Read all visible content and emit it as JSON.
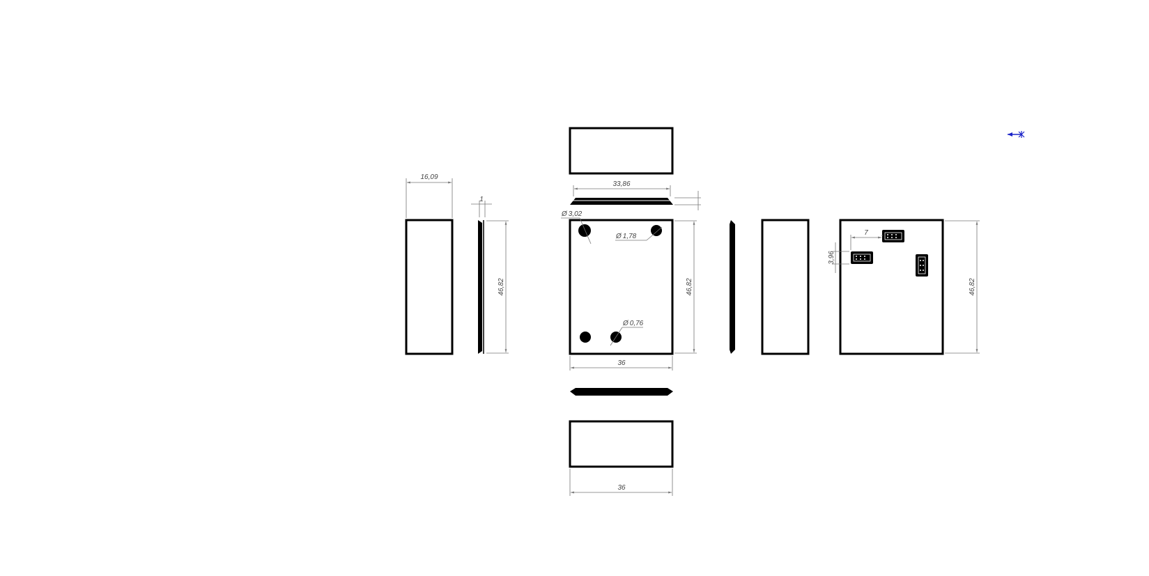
{
  "drawing": {
    "colors": {
      "outline": "#000000",
      "dimension": "#777777",
      "marker": "#1a23c8"
    },
    "left_view": {
      "width_label": "16,09"
    },
    "side_thin_view": {
      "thickness_label": "1",
      "height_label": "46,82"
    },
    "top_lid_view": {
      "width_label": "33,86"
    },
    "front_view": {
      "hole_large_label": "3,02",
      "hole_medium_label": "1,78",
      "hole_small_label": "0,76",
      "height_label": "46,82",
      "width_label": "36",
      "diameter_symbol": "Ø"
    },
    "bottom_view": {
      "width_label": "36"
    },
    "back_view": {
      "connector_spacing_label": "7",
      "connector_height_label": "3,96",
      "height_label": "46,82"
    },
    "marker": {
      "icon": "origin-marker-icon"
    }
  }
}
